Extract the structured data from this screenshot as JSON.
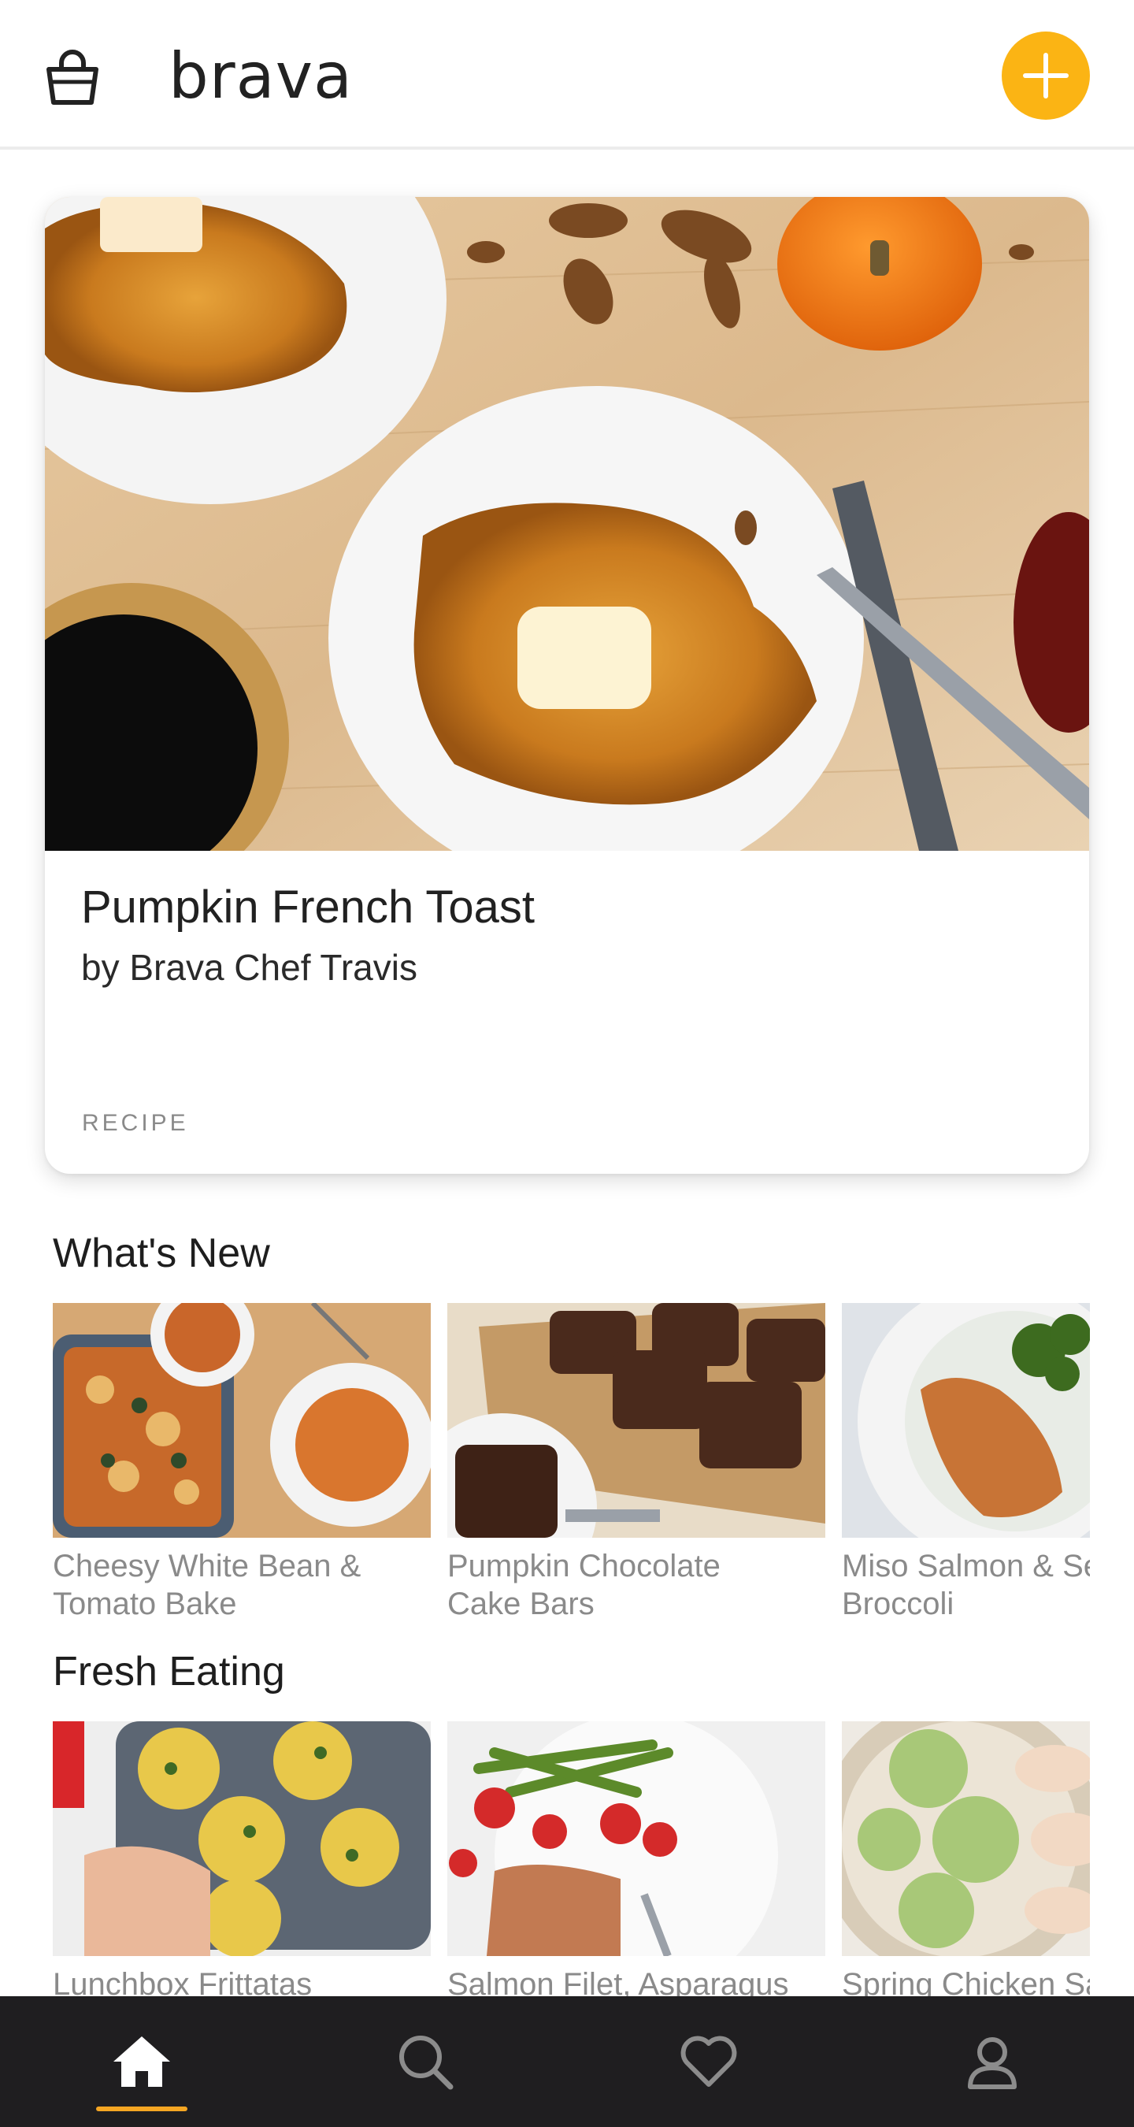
{
  "header": {
    "brand": "brava",
    "bag_icon": "shopping-bag-icon",
    "add_icon": "plus-icon",
    "accent_color": "#fbb414"
  },
  "featured": {
    "title": "Pumpkin French Toast",
    "author": "by Brava Chef Travis",
    "tag": "RECIPE"
  },
  "sections": [
    {
      "title": "What's New",
      "items": [
        {
          "label": "Cheesy White Bean &\nTomato Bake"
        },
        {
          "label": "Pumpkin Chocolate\nCake Bars"
        },
        {
          "label": "Miso Salmon & Se\nBroccoli"
        }
      ]
    },
    {
      "title": "Fresh Eating",
      "items": [
        {
          "label": "Lunchbox Frittatas"
        },
        {
          "label": "Salmon Filet, Asparagus"
        },
        {
          "label": "Spring Chicken Sa"
        }
      ]
    }
  ],
  "bottom_nav": {
    "items": [
      {
        "icon": "home-icon",
        "active": true
      },
      {
        "icon": "search-icon",
        "active": false
      },
      {
        "icon": "heart-icon",
        "active": false
      },
      {
        "icon": "profile-icon",
        "active": false
      }
    ],
    "active_color": "#f5a623"
  }
}
